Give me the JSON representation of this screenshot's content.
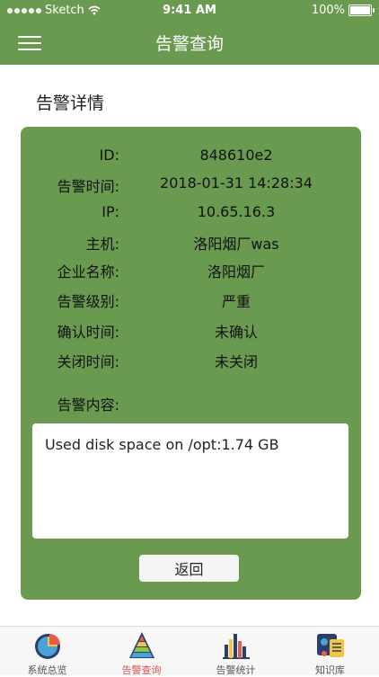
{
  "status_bar": {
    "carrier": "Sketch",
    "time": "9:41 AM",
    "battery": "100%"
  },
  "header": {
    "title": "告警查询",
    "menu_icon": "hamburger-icon"
  },
  "detail": {
    "section_title": "告警详情",
    "fields": [
      {
        "label": "ID:",
        "value": "848610e2"
      },
      {
        "label": "告警时间:",
        "value": "2018-01-31 14:28:34"
      },
      {
        "label": "IP:",
        "value": "10.65.16.3"
      },
      {
        "label": "主机:",
        "value": "洛阳烟厂was"
      },
      {
        "label": "企业名称:",
        "value": "洛阳烟厂"
      },
      {
        "label": "告警级别:",
        "value": "严重"
      },
      {
        "label": "确认时间:",
        "value": "未确认"
      },
      {
        "label": "关闭时间:",
        "value": "未关闭"
      }
    ],
    "content_label": "告警内容:",
    "content_text": "Used disk space on /opt:1.74 GB",
    "back_button": "返回",
    "card_color": "#6a9a4f"
  },
  "tabbar": {
    "active_color": "#d9534f",
    "tabs": [
      {
        "label": "系统总览",
        "icon": "pie-chart-icon",
        "active": false
      },
      {
        "label": "告警查询",
        "icon": "pyramid-icon",
        "active": true
      },
      {
        "label": "告警统计",
        "icon": "bar-chart-icon",
        "active": false
      },
      {
        "label": "知识库",
        "icon": "knowledge-icon",
        "active": false
      }
    ]
  }
}
